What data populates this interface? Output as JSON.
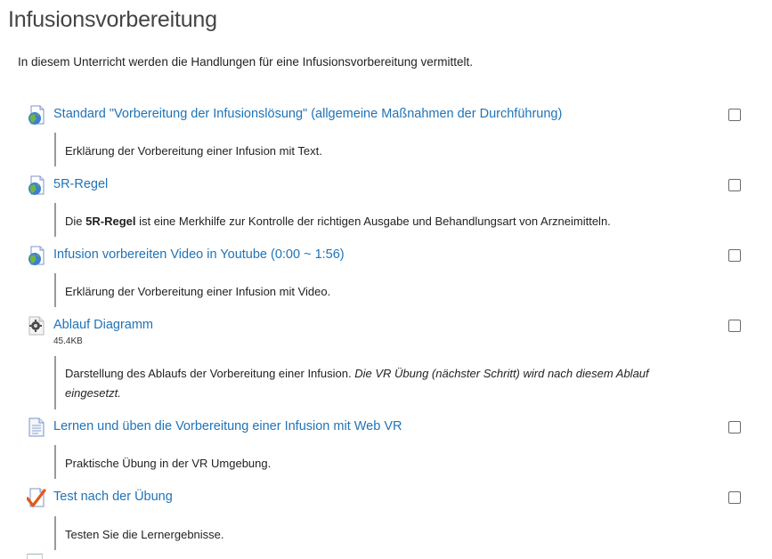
{
  "page": {
    "title": "Infusionsvorbereitung",
    "intro": "In diesem Unterricht werden die Handlungen für eine Infusionsvorbereitung vermittelt."
  },
  "activities": [
    {
      "icon": "url-globe-icon",
      "title": "Standard \"Vorbereitung der Infusionslösung\" (allgemeine Maßnahmen der Durchführung)",
      "description": "Erklärung der Vorbereitung einer Infusion mit Text."
    },
    {
      "icon": "url-globe-icon",
      "title": "5R-Regel",
      "description_before": "Die ",
      "description_bold": "5R-Regel",
      "description_after": " ist eine Merkhilfe zur Kontrolle der richtigen Ausgabe und Behandlungsart von Arzneimitteln."
    },
    {
      "icon": "url-globe-icon",
      "title": "Infusion vorbereiten Video in Youtube (0:00 ~ 1:56)",
      "description": "Erklärung der Vorbereitung einer Infusion mit Video."
    },
    {
      "icon": "file-icon",
      "title": "Ablauf Diagramm",
      "size": "45.4KB",
      "description_plain": "Darstellung des Ablaufs der Vorbereitung einer Infusion. ",
      "description_italic": "Die VR Übung (nächster Schritt) wird nach diesem Ablauf eingesetzt."
    },
    {
      "icon": "page-icon",
      "title": "Lernen und üben die Vorbereitung einer Infusion mit Web VR",
      "description": "Praktische Übung in der VR Umgebung."
    },
    {
      "icon": "quiz-check-icon",
      "title": "Test nach der Übung",
      "description": "Testen Sie die Lernergebnisse."
    }
  ],
  "colors": {
    "link": "#1f73b7",
    "globe_blue": "#3c7fd0",
    "globe_green": "#6fb34a",
    "quiz_orange": "#e05a1b"
  }
}
